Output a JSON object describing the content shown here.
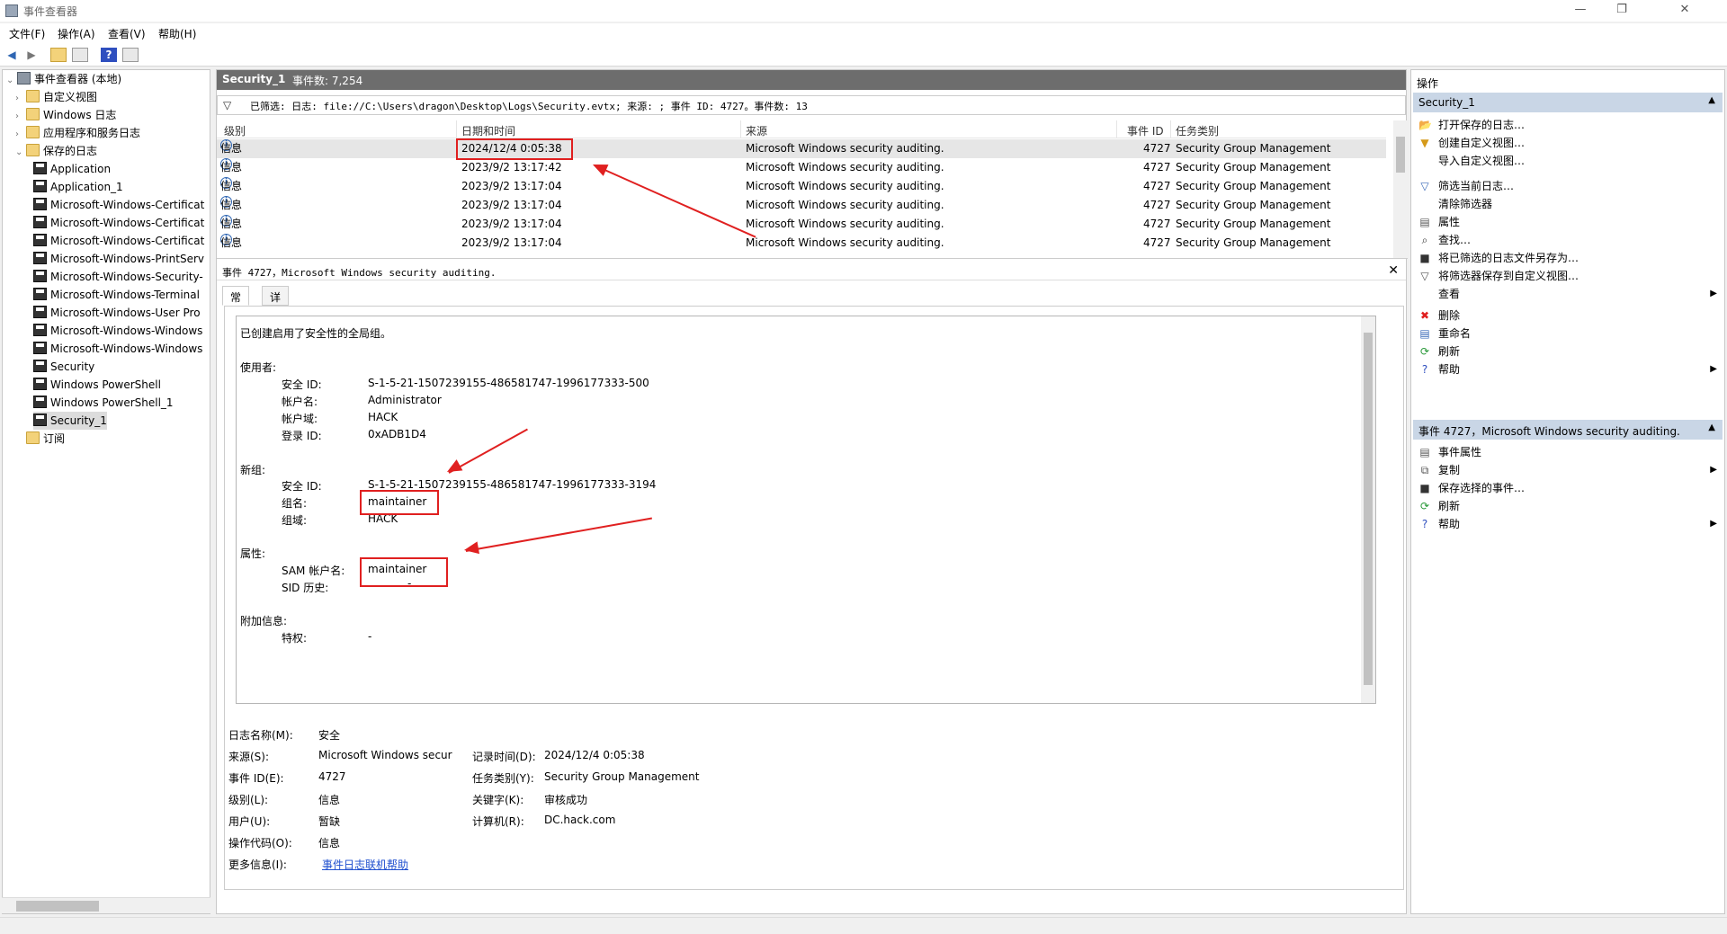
{
  "window": {
    "title": "事件查看器",
    "minimize": "—",
    "restore": "❐",
    "close": "✕"
  },
  "menu": [
    "文件(F)",
    "操作(A)",
    "查看(V)",
    "帮助(H)"
  ],
  "tree": {
    "root": "事件查看器 (本地)",
    "custom_views": "自定义视图",
    "windows_logs": "Windows 日志",
    "app_service_logs": "应用程序和服务日志",
    "saved_logs": "保存的日志",
    "saved": [
      "Application",
      "Application_1",
      "Microsoft-Windows-Certificat",
      "Microsoft-Windows-Certificat",
      "Microsoft-Windows-Certificat",
      "Microsoft-Windows-PrintServ",
      "Microsoft-Windows-Security-",
      "Microsoft-Windows-Terminal",
      "Microsoft-Windows-User Pro",
      "Microsoft-Windows-Windows",
      "Microsoft-Windows-Windows",
      "Security",
      "Windows PowerShell",
      "Windows PowerShell_1",
      "Security_1"
    ],
    "subscriptions": "订阅"
  },
  "center": {
    "log_name": "Security_1",
    "event_count": "事件数: 7,254",
    "filter": "已筛选: 日志: file://C:\\Users\\dragon\\Desktop\\Logs\\Security.evtx; 来源: ; 事件 ID: 4727。事件数: 13",
    "columns": {
      "level": "级别",
      "datetime": "日期和时间",
      "source": "来源",
      "event_id": "事件 ID",
      "task": "任务类别"
    },
    "rows": [
      {
        "level": "信息",
        "datetime": "2024/12/4 0:05:38",
        "source": "Microsoft Windows security auditing.",
        "event_id": "4727",
        "task": "Security Group Management"
      },
      {
        "level": "信息",
        "datetime": "2023/9/2 13:17:42",
        "source": "Microsoft Windows security auditing.",
        "event_id": "4727",
        "task": "Security Group Management"
      },
      {
        "level": "信息",
        "datetime": "2023/9/2 13:17:04",
        "source": "Microsoft Windows security auditing.",
        "event_id": "4727",
        "task": "Security Group Management"
      },
      {
        "level": "信息",
        "datetime": "2023/9/2 13:17:04",
        "source": "Microsoft Windows security auditing.",
        "event_id": "4727",
        "task": "Security Group Management"
      },
      {
        "level": "信息",
        "datetime": "2023/9/2 13:17:04",
        "source": "Microsoft Windows security auditing.",
        "event_id": "4727",
        "task": "Security Group Management"
      },
      {
        "level": "信息",
        "datetime": "2023/9/2 13:17:04",
        "source": "Microsoft Windows security auditing.",
        "event_id": "4727",
        "task": "Security Group Management"
      }
    ],
    "detail_title": "事件 4727，Microsoft Windows security auditing.",
    "tab_general": "常规",
    "tab_details": "详细信息",
    "desc": {
      "summary": "已创建启用了安全性的全局组。",
      "subject": "使用者:",
      "sid_label": "安全 ID:",
      "sid": "S-1-5-21-1507239155-486581747-1996177333-500",
      "account_label": "帐户名:",
      "account": "Administrator",
      "domain_label": "帐户域:",
      "domain": "HACK",
      "logon_label": "登录 ID:",
      "logon": "0xADB1D4",
      "new_group": "新组:",
      "ng_sid_label": "安全 ID:",
      "ng_sid": "S-1-5-21-1507239155-486581747-1996177333-3194",
      "ng_name_label": "组名:",
      "ng_name": "maintainer",
      "ng_domain_label": "组域:",
      "ng_domain": "HACK",
      "attributes": "属性:",
      "sam_label": "SAM 帐户名:",
      "sam": "maintainer",
      "sid_history_label": "SID 历史:",
      "sid_history": "-",
      "extra": "附加信息:",
      "priv_label": "特权:",
      "priv": "-"
    },
    "meta": {
      "log_name_label": "日志名称(M):",
      "log_name": "安全",
      "source_label": "来源(S):",
      "source": "Microsoft Windows secur",
      "recorded_label": "记录时间(D):",
      "recorded": "2024/12/4 0:05:38",
      "event_id_label": "事件 ID(E):",
      "event_id": "4727",
      "task_label": "任务类别(Y):",
      "task": "Security Group Management",
      "level_label": "级别(L):",
      "level": "信息",
      "keywords_label": "关键字(K):",
      "keywords": "审核成功",
      "user_label": "用户(U):",
      "user": "暂缺",
      "computer_label": "计算机(R):",
      "computer": "DC.hack.com",
      "opcode_label": "操作代码(O):",
      "opcode": "信息",
      "more_label": "更多信息(I):",
      "more_link": "事件日志联机帮助"
    }
  },
  "actions": {
    "title": "操作",
    "section1": "Security_1",
    "items1": [
      "打开保存的日志…",
      "创建自定义视图…",
      "导入自定义视图…",
      "筛选当前日志…",
      "清除筛选器",
      "属性",
      "查找…",
      "将已筛选的日志文件另存为…",
      "将筛选器保存到自定义视图…",
      "查看",
      "删除",
      "重命名",
      "刷新",
      "帮助"
    ],
    "section2": "事件 4727，Microsoft Windows security auditing.",
    "items2": [
      "事件属性",
      "复制",
      "保存选择的事件…",
      "刷新",
      "帮助"
    ]
  }
}
